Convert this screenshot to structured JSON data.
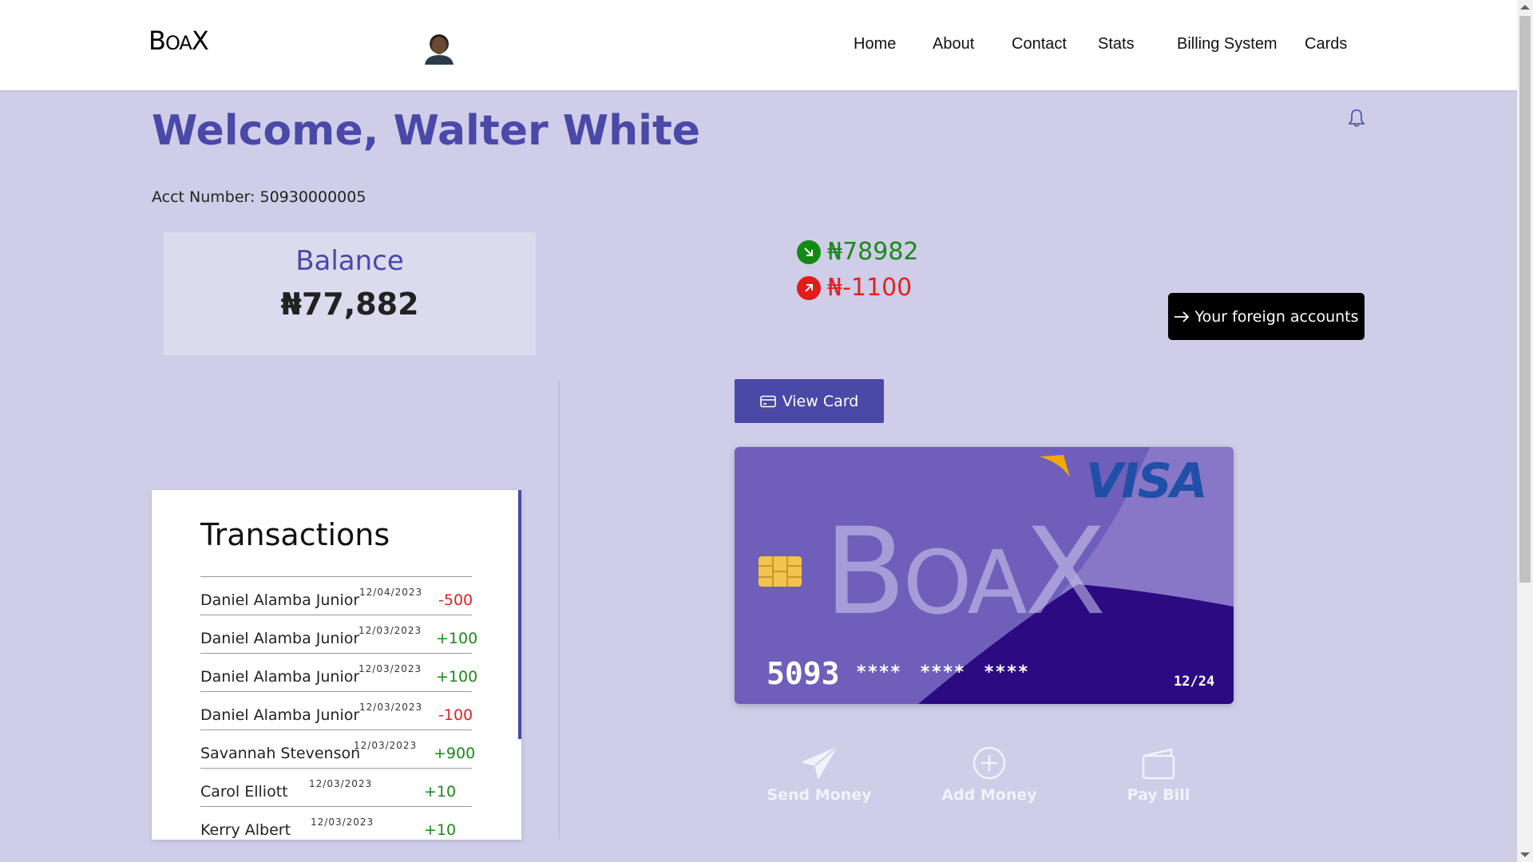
{
  "nav": {
    "logo": {
      "b": "B",
      "oa": "OA",
      "x": "X"
    },
    "links": [
      "Home",
      "About",
      "Contact",
      "Stats",
      "Billing System",
      "Cards"
    ]
  },
  "welcome": "Welcome, Walter White",
  "account": "Acct Number: 50930000005",
  "balance": {
    "title": "Balance",
    "amount": "₦77,882"
  },
  "flows": {
    "income": "₦78982",
    "expense": "₦-1100"
  },
  "foreign_button": "Your foreign accounts",
  "view_card_button": "View Card",
  "transactions": {
    "title": "Transactions",
    "rows": [
      {
        "name": "Daniel Alamba Junior",
        "date": "12/04/2023",
        "amount": "-500",
        "type": "neg"
      },
      {
        "name": "Daniel Alamba Junior",
        "date": "12/03/2023",
        "amount": "+100",
        "type": "pos"
      },
      {
        "name": "Daniel Alamba Junior",
        "date": "12/03/2023",
        "amount": "+100",
        "type": "pos"
      },
      {
        "name": "Daniel Alamba Junior",
        "date": "12/03/2023",
        "amount": "-100",
        "type": "neg"
      },
      {
        "name": "Savannah Stevenson",
        "date": "12/03/2023",
        "amount": "+900",
        "type": "pos"
      },
      {
        "name": "Carol Elliott",
        "date": "12/03/2023",
        "amount": "+10",
        "type": "pos"
      },
      {
        "name": "Kerry Albert",
        "date": "12/03/2023",
        "amount": "+10",
        "type": "pos"
      }
    ]
  },
  "card": {
    "brand": "VISA",
    "logo": {
      "b": "B",
      "oa": "OA",
      "x": "X"
    },
    "number_lead": "5093",
    "masked": [
      "****",
      "****",
      "****"
    ],
    "expiry": "12/24"
  },
  "actions": [
    {
      "label": "Send Money",
      "icon": "send-icon"
    },
    {
      "label": "Add Money",
      "icon": "plus-circle-icon"
    },
    {
      "label": "Pay Bill",
      "icon": "wallet-icon"
    }
  ],
  "colors": {
    "accent": "#4a49a8",
    "background": "#cfcde8",
    "positive": "#1a8a1a",
    "negative": "#e22222"
  }
}
